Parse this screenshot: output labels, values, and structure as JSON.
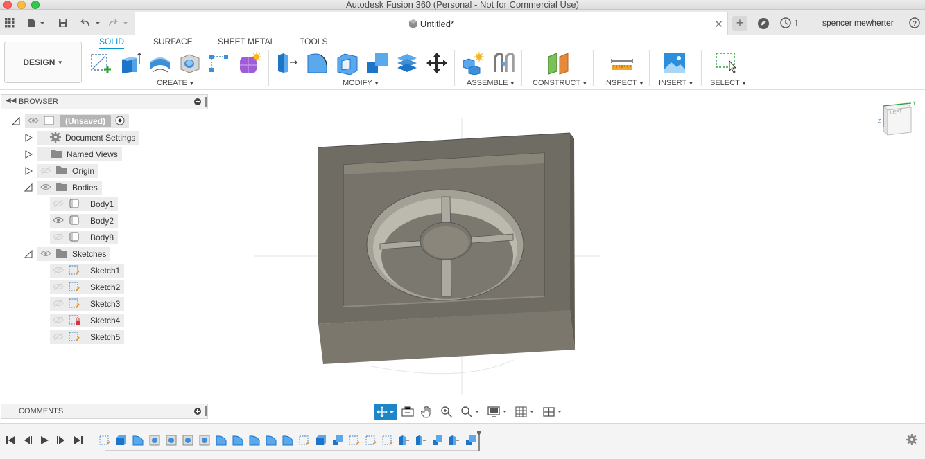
{
  "window": {
    "title": "Autodesk Fusion 360 (Personal - Not for Commercial Use)"
  },
  "document_tab": {
    "title": "Untitled*"
  },
  "header": {
    "user_name": "spencer mewherter",
    "job_count": "1"
  },
  "toolbar": {
    "tabs": [
      "SOLID",
      "SURFACE",
      "SHEET METAL",
      "TOOLS"
    ],
    "active_tab": "SOLID",
    "workspace": "DESIGN",
    "groups": [
      "CREATE",
      "MODIFY",
      "ASSEMBLE",
      "CONSTRUCT",
      "INSPECT",
      "INSERT",
      "SELECT"
    ]
  },
  "browser": {
    "title": "BROWSER",
    "root": "(Unsaved)",
    "items": [
      {
        "label": "Document Settings",
        "icon": "gear-icon"
      },
      {
        "label": "Named Views",
        "icon": "folder-icon"
      },
      {
        "label": "Origin",
        "icon": "folder-icon"
      },
      {
        "label": "Bodies",
        "icon": "folder-icon"
      },
      {
        "label": "Body1",
        "icon": "body-icon"
      },
      {
        "label": "Body2",
        "icon": "body-icon"
      },
      {
        "label": "Body8",
        "icon": "body-icon"
      },
      {
        "label": "Sketches",
        "icon": "folder-icon"
      },
      {
        "label": "Sketch1",
        "icon": "sketch-icon"
      },
      {
        "label": "Sketch2",
        "icon": "sketch-icon"
      },
      {
        "label": "Sketch3",
        "icon": "sketch-icon"
      },
      {
        "label": "Sketch4",
        "icon": "sketch-locked-icon"
      },
      {
        "label": "Sketch5",
        "icon": "sketch-icon"
      }
    ]
  },
  "comments": {
    "title": "COMMENTS"
  },
  "viewcube": {
    "face": "LEFT"
  },
  "colors": {
    "accent": "#0696d7",
    "body": "#6f6c63"
  }
}
